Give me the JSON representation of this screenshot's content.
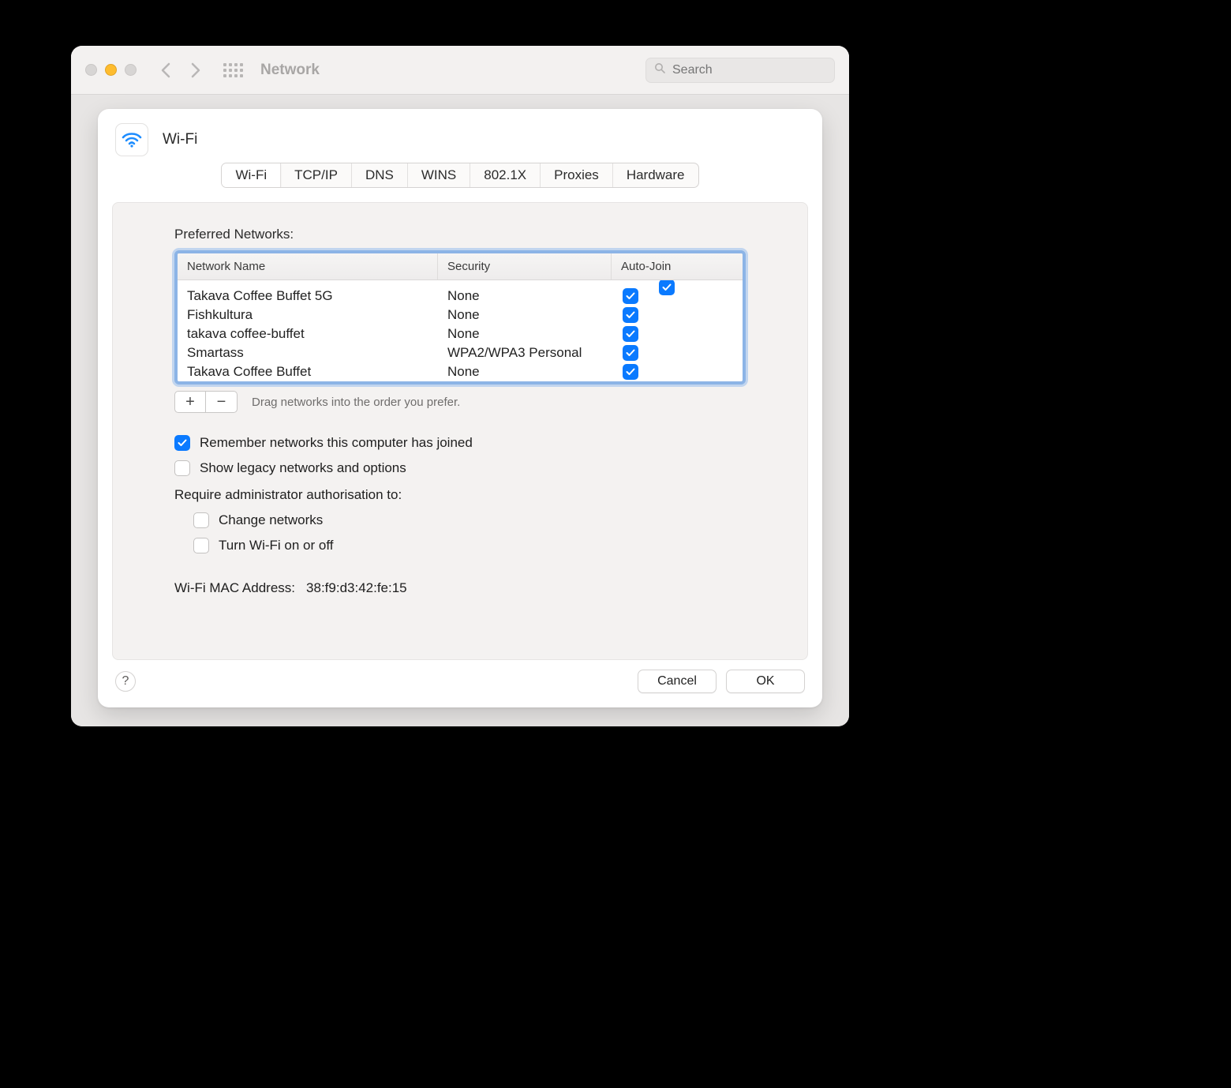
{
  "titlebar": {
    "title": "Network",
    "search_placeholder": "Search"
  },
  "sheet": {
    "title": "Wi-Fi",
    "tabs": [
      "Wi-Fi",
      "TCP/IP",
      "DNS",
      "WINS",
      "802.1X",
      "Proxies",
      "Hardware"
    ],
    "active_tab": 0,
    "section_label": "Preferred Networks:",
    "columns": {
      "name": "Network Name",
      "security": "Security",
      "autojoin": "Auto-Join"
    },
    "networks": [
      {
        "name": "Takava Coffee Buffet 5G",
        "security": "None",
        "autojoin": true
      },
      {
        "name": "Fishkultura",
        "security": "None",
        "autojoin": true
      },
      {
        "name": "takava coffee-buffet",
        "security": "None",
        "autojoin": true
      },
      {
        "name": "Smartass",
        "security": "WPA2/WPA3 Personal",
        "autojoin": true
      },
      {
        "name": "Takava Coffee Buffet",
        "security": "None",
        "autojoin": true
      }
    ],
    "drag_hint": "Drag networks into the order you prefer.",
    "remember": {
      "checked": true,
      "label": "Remember networks this computer has joined"
    },
    "legacy": {
      "checked": false,
      "label": "Show legacy networks and options"
    },
    "admin_label": "Require administrator authorisation to:",
    "admin_change": {
      "checked": false,
      "label": "Change networks"
    },
    "admin_wifi": {
      "checked": false,
      "label": "Turn Wi-Fi on or off"
    },
    "mac_label": "Wi-Fi MAC Address:",
    "mac_value": "38:f9:d3:42:fe:15",
    "cancel": "Cancel",
    "ok": "OK"
  }
}
